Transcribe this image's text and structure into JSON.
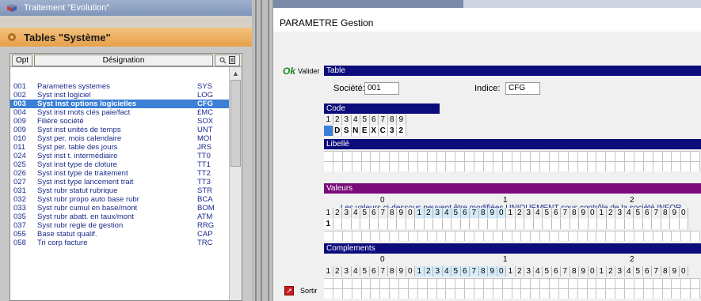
{
  "tree": {
    "node1": "Traitement \"Evolution\"",
    "node2": "Tables \"Système\""
  },
  "list": {
    "headers": {
      "opt": "Opt",
      "designation": "Désignation"
    },
    "rows": [
      {
        "opt": "001",
        "desig": "Parametres systemes",
        "code": "SYS"
      },
      {
        "opt": "002",
        "desig": "Syst inst  logiciel",
        "code": "LOG"
      },
      {
        "opt": "003",
        "desig": "Syst inst options logicielles",
        "code": "CFG",
        "selected": true
      },
      {
        "opt": "004",
        "desig": "Syst inst mots clés paie/fact",
        "code": "£MC"
      },
      {
        "opt": "009",
        "desig": "Filière société",
        "code": "SOX"
      },
      {
        "opt": "009",
        "desig": "Syst inst unités de temps",
        "code": "UNT"
      },
      {
        "opt": "010",
        "desig": "Syst per. mois calendaire",
        "code": "MOI"
      },
      {
        "opt": "011",
        "desig": "Syst per. table des jours",
        "code": "JRS"
      },
      {
        "opt": "024",
        "desig": "Syst inst t. intermédiaire",
        "code": "TT0"
      },
      {
        "opt": "025",
        "desig": "Syst inst type de cloture",
        "code": "TT1"
      },
      {
        "opt": "026",
        "desig": "Syst inst type de traitement",
        "code": "TT2"
      },
      {
        "opt": "027",
        "desig": "Syst inst type lancement trait",
        "code": "TT3"
      },
      {
        "opt": "031",
        "desig": "Syst rubr statut rubrique",
        "code": "STR"
      },
      {
        "opt": "032",
        "desig": "Syst rubr propo auto base rubr",
        "code": "BCA"
      },
      {
        "opt": "033",
        "desig": "Syst rubr cumul en base/mont",
        "code": "BOM"
      },
      {
        "opt": "035",
        "desig": "Syst rubr abatt. en taux/mont",
        "code": "ATM"
      },
      {
        "opt": "037",
        "desig": "Syst rubr regle de gestion",
        "code": "RRG"
      },
      {
        "opt": "055",
        "desig": "Base          statut qualif.",
        "code": "CAP"
      },
      {
        "opt": "058",
        "desig": "Tri corp facture",
        "code": "TRC"
      }
    ]
  },
  "window": {
    "title": "PARAMETRE Gestion"
  },
  "actions": {
    "ok_icon": "Ok",
    "validate": "Valider",
    "exit": "Sortir"
  },
  "form": {
    "table_bar": "Table",
    "societe_label": "Société:",
    "societe_value": "001",
    "indice_label": "Indice:",
    "indice_value": "CFG",
    "code_bar": "Code",
    "code_digits": [
      "1",
      "2",
      "3",
      "4",
      "5",
      "6",
      "7",
      "8",
      "9"
    ],
    "code_chars": [
      "",
      "D",
      "S",
      "N",
      "E",
      "X",
      "C",
      "3",
      "2"
    ],
    "libelle_bar": "Libellé",
    "notice": "Les valeurs ci-dessous peuvent être modifiées UNIQUEMENT sous contrôle de la société INFOR.",
    "valeurs_bar": "Valeurs",
    "tens": [
      "0",
      "1",
      "2"
    ],
    "valeurs_first": "1",
    "complements_bar": "Complements"
  },
  "colors": {
    "bar_blue": "#0c0c7c",
    "bar_purple": "#7a0a7a",
    "selection": "#3b7fd6"
  }
}
